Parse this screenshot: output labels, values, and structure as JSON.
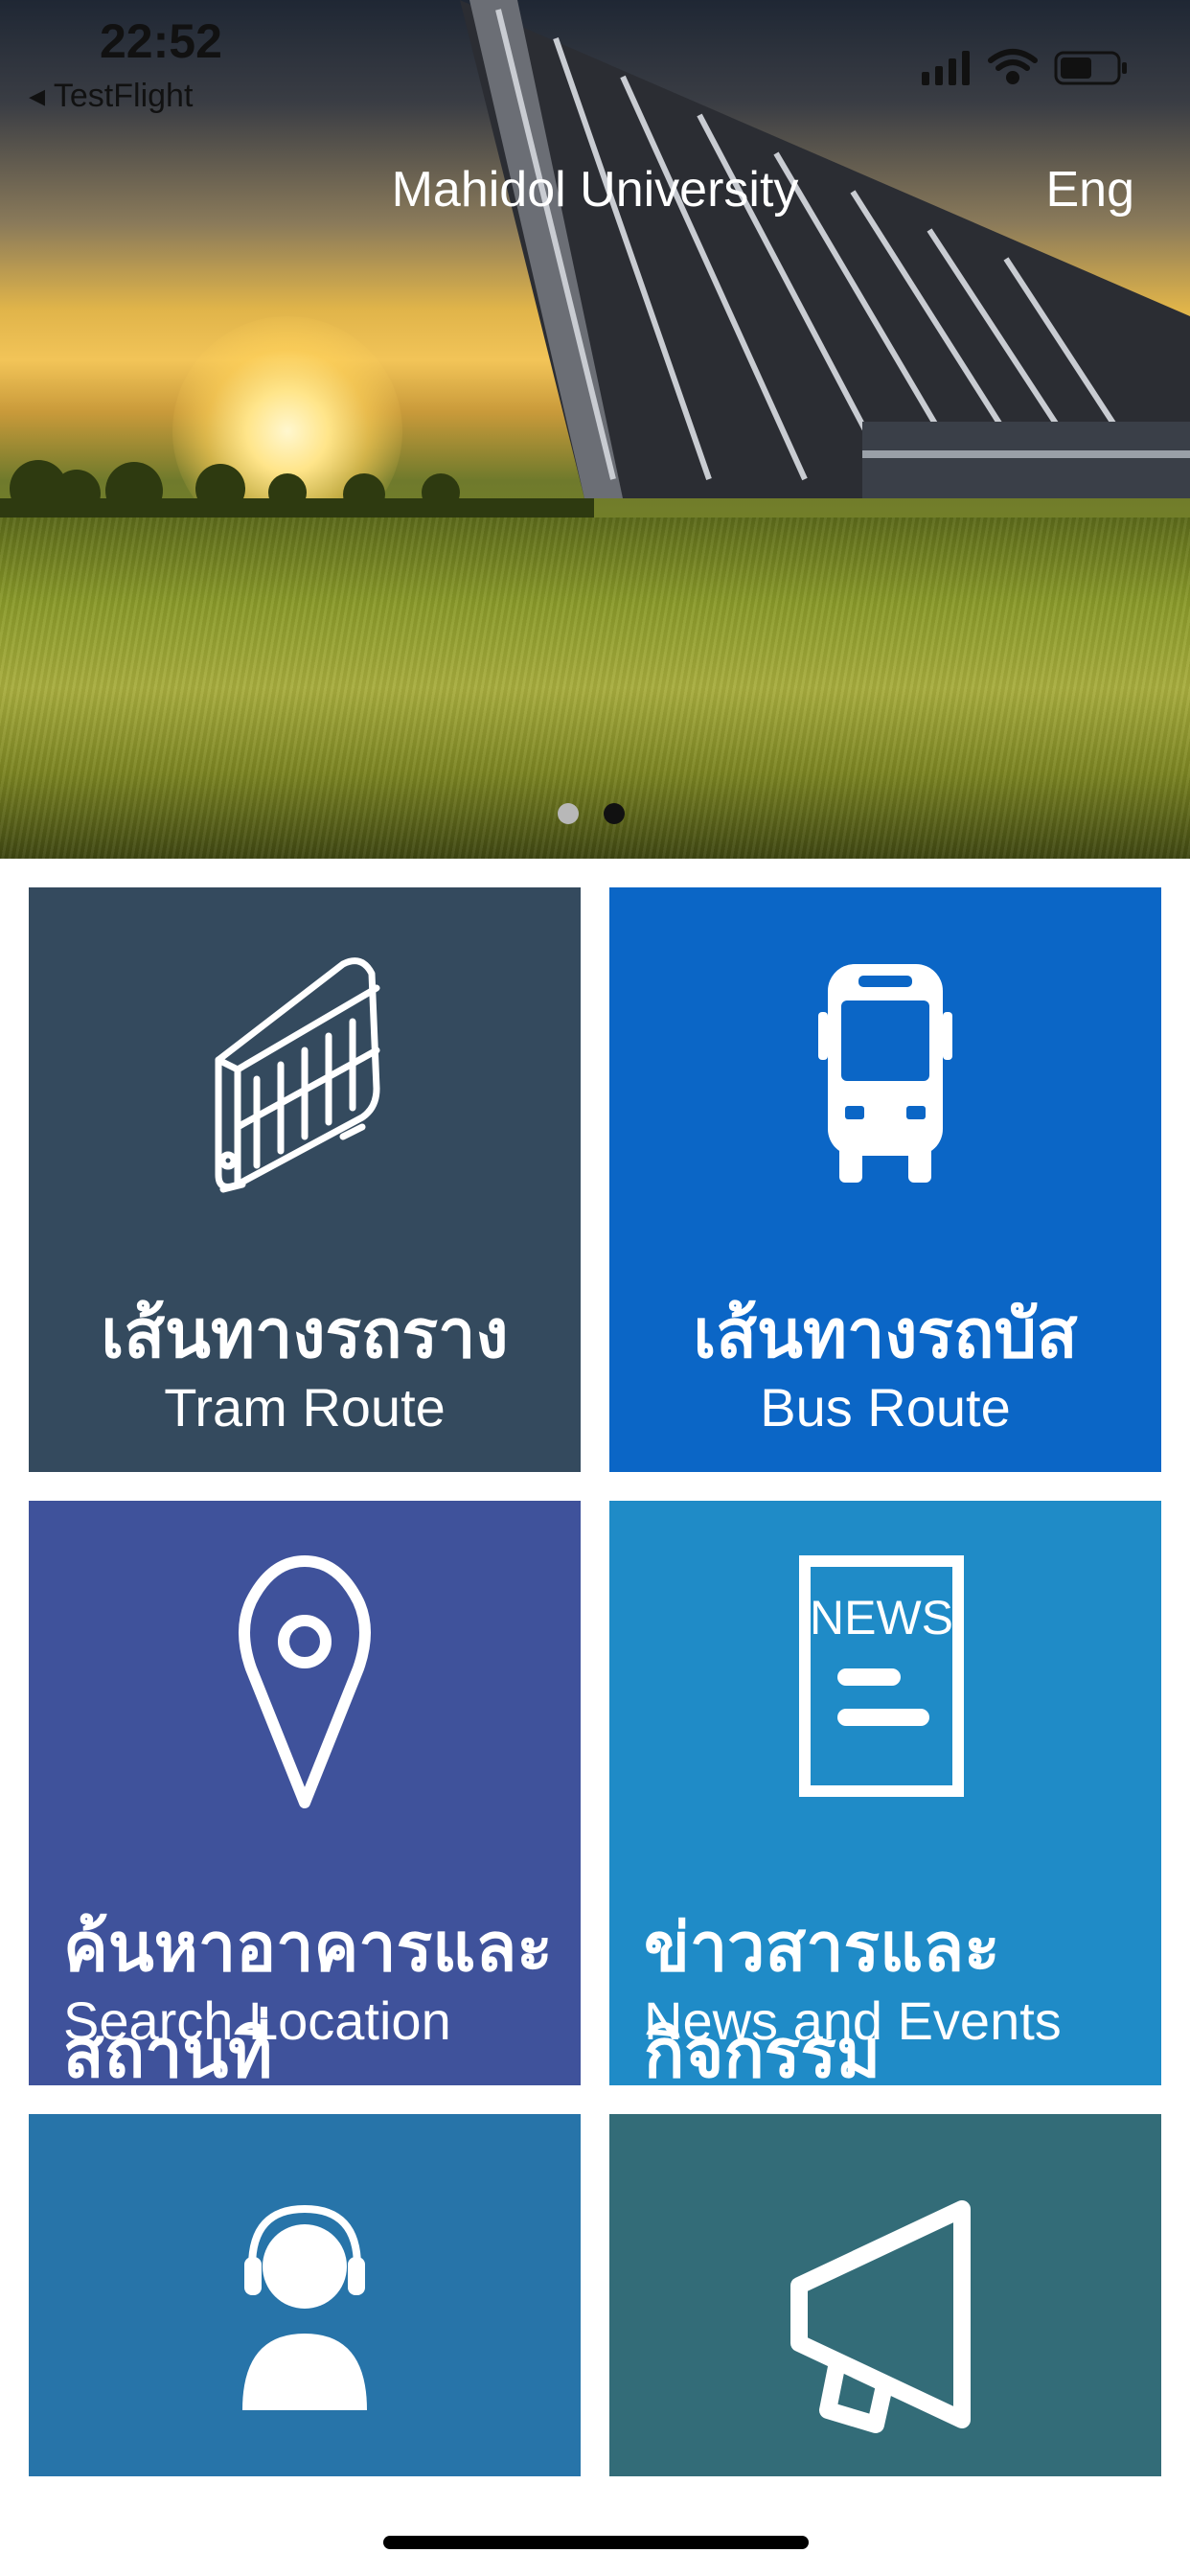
{
  "status_bar": {
    "time": "22:52",
    "back_app": "◂ TestFlight"
  },
  "header": {
    "title": "Mahidol University",
    "language": "Eng"
  },
  "carousel": {
    "count": 2,
    "active_index": 1
  },
  "tiles": [
    {
      "th": "เส้นทางรถราง",
      "en": "Tram Route",
      "icon": "tram-icon",
      "color": "#344a5e"
    },
    {
      "th": "เส้นทางรถบัส",
      "en": "Bus Route",
      "icon": "bus-icon",
      "color": "#0b66c6"
    },
    {
      "th": "ค้นหาอาคารและสถานที่",
      "en": "Search Location",
      "icon": "location-pin-icon",
      "color": "#3f529b"
    },
    {
      "th": "ข่าวสารและกิจกรรม",
      "en": "News and Events",
      "icon": "news-icon",
      "color": "#1f8bc7"
    },
    {
      "icon": "support-agent-icon",
      "color": "#2774a9"
    },
    {
      "icon": "megaphone-icon",
      "color": "#336c78"
    }
  ],
  "news_icon_text": "NEWS"
}
